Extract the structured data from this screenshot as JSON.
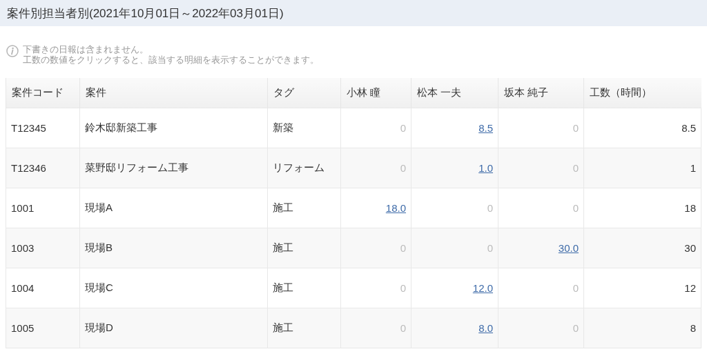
{
  "title": "案件別担当者別(2021年10月01日～2022年03月01日)",
  "notes": [
    "下書きの日報は含まれません。",
    "工数の数値をクリックすると、該当する明細を表示することができます。"
  ],
  "table": {
    "columns": [
      "案件コード",
      "案件",
      "タグ",
      "小林 瞳",
      "松本 一夫",
      "坂本 純子",
      "工数（時間）"
    ],
    "rows": [
      {
        "code": "T12345",
        "name": "鈴木邸新築工事",
        "tag": "新築",
        "hours": [
          {
            "text": "0",
            "kind": "zero"
          },
          {
            "text": "8.5",
            "kind": "link"
          },
          {
            "text": "0",
            "kind": "zero"
          }
        ],
        "total": "8.5"
      },
      {
        "code": "T12346",
        "name": "菜野邸リフォーム工事",
        "tag": "リフォーム",
        "hours": [
          {
            "text": "0",
            "kind": "zero"
          },
          {
            "text": "1.0",
            "kind": "link"
          },
          {
            "text": "0",
            "kind": "zero"
          }
        ],
        "total": "1"
      },
      {
        "code": "1001",
        "name": "現場A",
        "tag": "施工",
        "hours": [
          {
            "text": "18.0",
            "kind": "link"
          },
          {
            "text": "0",
            "kind": "zero"
          },
          {
            "text": "0",
            "kind": "zero"
          }
        ],
        "total": "18"
      },
      {
        "code": "1003",
        "name": "現場B",
        "tag": "施工",
        "hours": [
          {
            "text": "0",
            "kind": "zero"
          },
          {
            "text": "0",
            "kind": "zero"
          },
          {
            "text": "30.0",
            "kind": "link"
          }
        ],
        "total": "30"
      },
      {
        "code": "1004",
        "name": "現場C",
        "tag": "施工",
        "hours": [
          {
            "text": "0",
            "kind": "zero"
          },
          {
            "text": "12.0",
            "kind": "link"
          },
          {
            "text": "0",
            "kind": "zero"
          }
        ],
        "total": "12"
      },
      {
        "code": "1005",
        "name": "現場D",
        "tag": "施工",
        "hours": [
          {
            "text": "0",
            "kind": "zero"
          },
          {
            "text": "8.0",
            "kind": "link"
          },
          {
            "text": "0",
            "kind": "zero"
          }
        ],
        "total": "8"
      }
    ]
  }
}
